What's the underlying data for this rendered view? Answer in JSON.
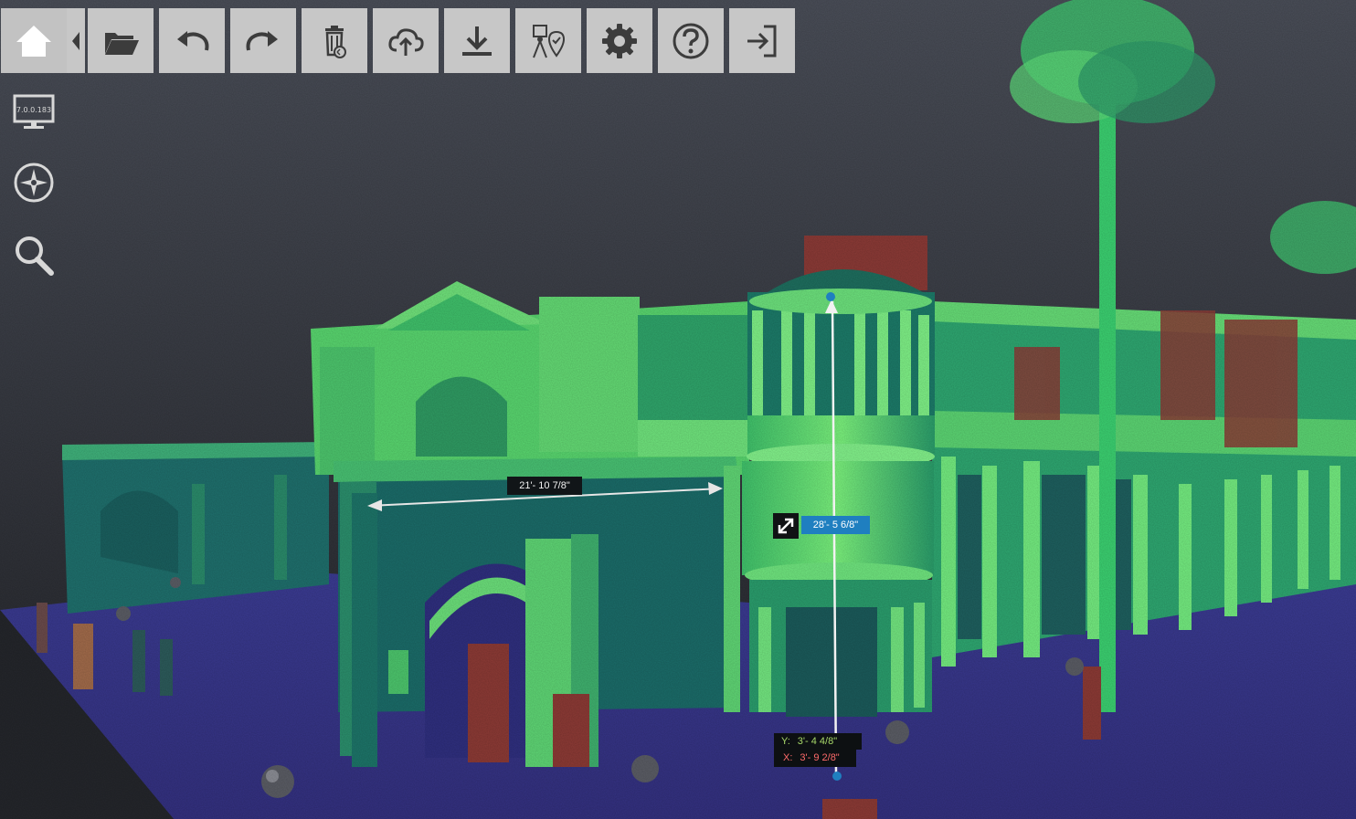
{
  "toolbar": {
    "buttons": [
      {
        "id": "home",
        "icon": "home-icon"
      },
      {
        "id": "open",
        "icon": "folder-open-icon"
      },
      {
        "id": "undo",
        "icon": "undo-icon"
      },
      {
        "id": "redo",
        "icon": "redo-icon"
      },
      {
        "id": "delete",
        "icon": "trash-restore-icon"
      },
      {
        "id": "upload",
        "icon": "cloud-upload-icon"
      },
      {
        "id": "download",
        "icon": "download-icon"
      },
      {
        "id": "georeference",
        "icon": "survey-location-icon"
      },
      {
        "id": "settings",
        "icon": "gear-icon"
      },
      {
        "id": "help",
        "icon": "help-icon"
      },
      {
        "id": "exit",
        "icon": "exit-icon"
      }
    ]
  },
  "sidebar": {
    "display_version": "7.0.0.183",
    "items": [
      {
        "id": "display",
        "icon": "monitor-icon"
      },
      {
        "id": "navigation",
        "icon": "compass-icon"
      },
      {
        "id": "search",
        "icon": "search-icon"
      }
    ]
  },
  "measurements": {
    "horizontal": "21'- 10 7/8\"",
    "vertical": "28'- 5 6/8\"",
    "y_key": "Y:",
    "y_value": "3'- 4 4/8\"",
    "x_key": "X:",
    "x_value": "3'- 9 2/8\""
  },
  "colors": {
    "toolbar_button": "#c7c7c7",
    "icon": "#3c3c3c",
    "vertical_label": "#1f7fc0",
    "x_axis": "#ff6b6b",
    "y_axis": "#a8d86a",
    "point_cloud_bright": "#5ee06a",
    "point_cloud_teal": "#1c7a6c",
    "ground": "#3c3a8c"
  }
}
